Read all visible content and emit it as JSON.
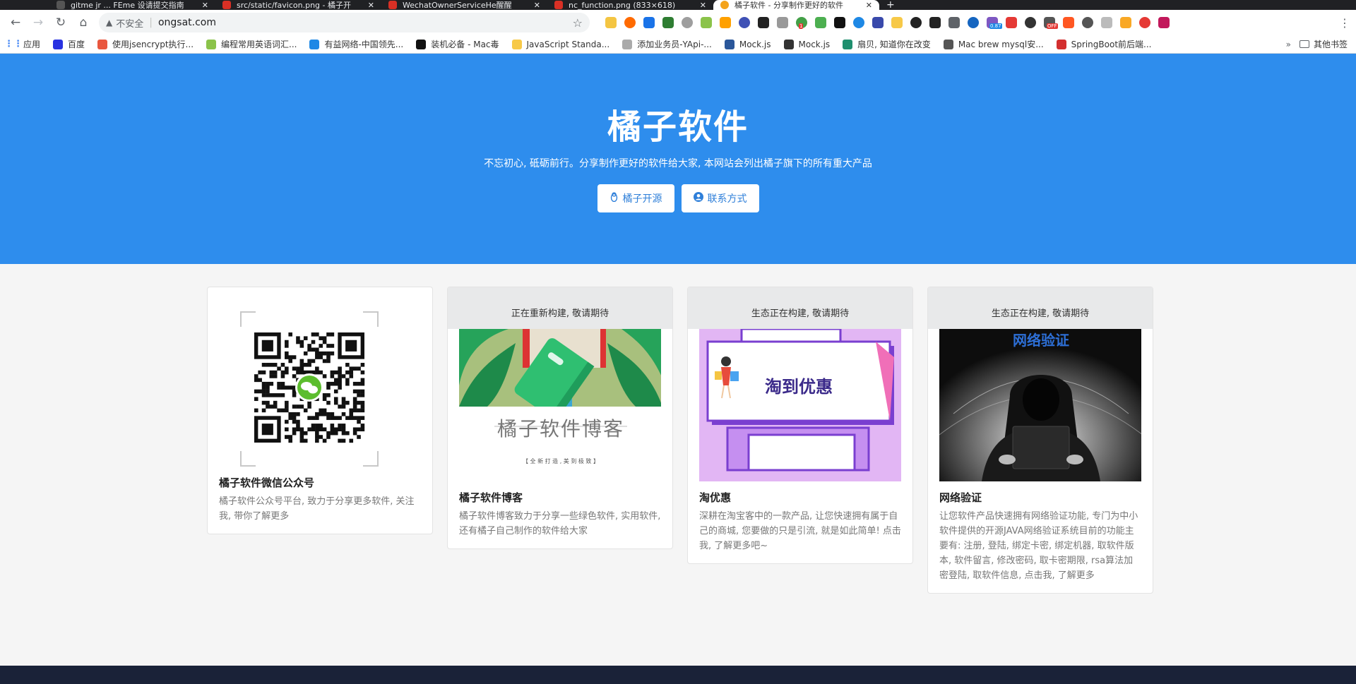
{
  "browser": {
    "tabs": [
      {
        "title": "gitme jr ... FEme 设请提交指南",
        "color": "#555"
      },
      {
        "title": "src/static/favicon.png - 橘子开",
        "color": "#d93025"
      },
      {
        "title": "WechatOwnerServiceHe醒醒",
        "color": "#d93025"
      },
      {
        "title": "nc_function.png (833×618)",
        "color": "#d93025"
      },
      {
        "title": "橘子软件 - 分享制作更好的软件",
        "color": "#f4a31b"
      }
    ],
    "new_tab": "+",
    "address": {
      "security_label": "不安全",
      "url": "ongsat.com"
    },
    "ext_badges": {
      "badge1": "1",
      "badge2": "0.87",
      "badge3": "OFF"
    },
    "extension_colors": [
      "#f4c542",
      "#ff6a00",
      "#1a73e8",
      "#2e7d32",
      "#9e9e9e",
      "#8bc34a",
      "#ffa000",
      "#3f51b5",
      "#222",
      "#999",
      "#43a047",
      "#4caf50",
      "#111",
      "#1e88e5",
      "#3949ab",
      "#f7c948",
      "#222",
      "#222",
      "#5f6368",
      "#1565c0",
      "#7e57c2",
      "#e53935",
      "#333",
      "#555",
      "#ff5722",
      "#555",
      "#bbb",
      "#f9a825",
      "#e53935",
      "#c2185b"
    ],
    "bookmarks": [
      {
        "label": "应用",
        "icon": "apps-grid-icon",
        "color": "#4285f4"
      },
      {
        "label": "百度",
        "icon": "baidu-paw-icon",
        "color": "#2932e1"
      },
      {
        "label": "使用jsencrypt执行...",
        "icon": "jianshu-icon",
        "color": "#e9573f"
      },
      {
        "label": "编程常用英语词汇...",
        "icon": "circle-icon",
        "color": "#8bc34a"
      },
      {
        "label": "有益网络-中国领先...",
        "icon": "globe-icon",
        "color": "#1e88e5"
      },
      {
        "label": "装机必备 - Mac毒",
        "icon": "mac-icon",
        "color": "#111"
      },
      {
        "label": "JavaScript Standa...",
        "icon": "standard-icon",
        "color": "#f7c948"
      },
      {
        "label": "添加业务员-YApi-...",
        "icon": "yapi-icon",
        "color": "#aaa"
      },
      {
        "label": "Mock.js",
        "icon": "word-icon",
        "color": "#2b579a"
      },
      {
        "label": "Mock.js",
        "icon": "github-icon",
        "color": "#333"
      },
      {
        "label": "扇贝, 知道你在改变",
        "icon": "shanbay-icon",
        "color": "#1f8f6e"
      },
      {
        "label": "Mac brew mysql安...",
        "icon": "yuque-icon",
        "color": "#555"
      },
      {
        "label": "SpringBoot前后端...",
        "icon": "csdn-icon",
        "color": "#d32f2f"
      }
    ],
    "bookmarks_more": "»",
    "other_bookmarks": "其他书签"
  },
  "hero": {
    "title": "橘子软件",
    "subtitle": "不忘初心, 砥砺前行。分享制作更好的软件给大家, 本网站会列出橘子旗下的所有重大产品",
    "buttons": [
      {
        "label": "橘子开源",
        "icon": "penguin-icon"
      },
      {
        "label": "联系方式",
        "icon": "user-circle-icon"
      }
    ]
  },
  "cards": [
    {
      "head": "",
      "title": "橘子软件微信公众号",
      "desc": "橘子软件公众号平台, 致力于分享更多软件, 关注我, 带你了解更多",
      "image": "wechat-qr-code"
    },
    {
      "head": "正在重新构建, 敬请期待",
      "title": "橘子软件博客",
      "desc": "橘子软件博客致力于分享一些绿色软件, 实用软件, 还有橘子自己制作的软件给大家",
      "image_text": "橘子软件博客",
      "image_subtext": "【 全 新 打 造 , 美 到 极 致 】"
    },
    {
      "head": "生态正在构建, 敬请期待",
      "title": "淘优惠",
      "desc": "深耕在淘宝客中的一款产品, 让您快速拥有属于自己的商城, 您要做的只是引流, 就是如此简单! 点击我, 了解更多吧~",
      "image_text": "淘到优惠"
    },
    {
      "head": "生态正在构建, 敬请期待",
      "title": "网络验证",
      "desc": "让您软件产品快速拥有网络验证功能, 专门为中小软件提供的开源JAVA网络验证系统目前的功能主要有: 注册, 登陆, 绑定卡密, 绑定机器, 取软件版本, 软件留言, 修改密码, 取卡密期限, rsa算法加密登陆, 取软件信息, 点击我, 了解更多",
      "image_text": "网络验证"
    }
  ],
  "colors": {
    "hero_bg": "#2e8ded",
    "footer_bg": "#1a2238",
    "page_bg": "#f5f5f5"
  }
}
